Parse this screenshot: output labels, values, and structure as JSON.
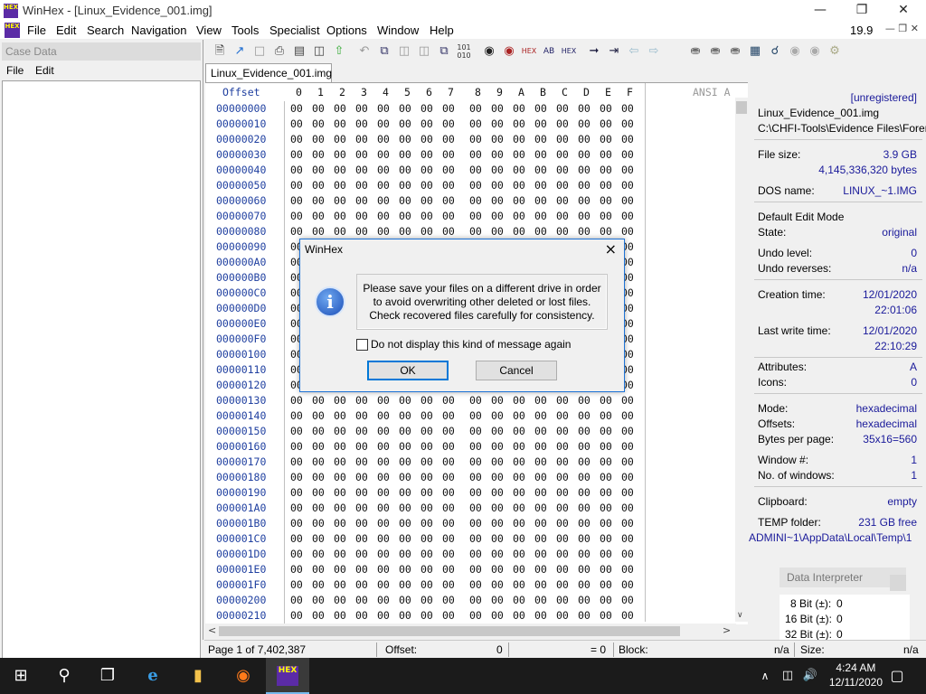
{
  "window": {
    "title": "WinHex - [Linux_Evidence_001.img]",
    "app_icon_text": "HEX",
    "mdi_version": "19.9"
  },
  "menu": [
    "File",
    "Edit",
    "Search",
    "Navigation",
    "View",
    "Tools",
    "Specialist",
    "Options",
    "Window",
    "Help"
  ],
  "case_pane": {
    "header": "Case Data",
    "menu_file": "File",
    "menu_edit": "Edit"
  },
  "tab": {
    "label": "Linux_Evidence_001.img"
  },
  "hex": {
    "offset_header": "Offset",
    "col_headers": [
      "0",
      "1",
      "2",
      "3",
      "4",
      "5",
      "6",
      "7",
      "8",
      "9",
      "A",
      "B",
      "C",
      "D",
      "E",
      "F"
    ],
    "ansi_header": "ANSI A",
    "offsets": [
      "00000000",
      "00000010",
      "00000020",
      "00000030",
      "00000040",
      "00000050",
      "00000060",
      "00000070",
      "00000080",
      "00000090",
      "000000A0",
      "000000B0",
      "000000C0",
      "000000D0",
      "000000E0",
      "000000F0",
      "00000100",
      "00000110",
      "00000120",
      "00000130",
      "00000140",
      "00000150",
      "00000160",
      "00000170",
      "00000180",
      "00000190",
      "000001A0",
      "000001B0",
      "000001C0",
      "000001D0",
      "000001E0",
      "000001F0",
      "00000200",
      "00000210"
    ],
    "byte_value": "00"
  },
  "info": {
    "registration": "[unregistered]",
    "file_name": "Linux_Evidence_001.img",
    "file_path": "C:\\CHFI-Tools\\Evidence Files\\Foren",
    "file_size_label": "File size:",
    "file_size": "3.9 GB",
    "file_size_bytes": "4,145,336,320 bytes",
    "dos_name_label": "DOS name:",
    "dos_name": "LINUX_~1.IMG",
    "edit_mode": "Default Edit Mode",
    "state_label": "State:",
    "state": "original",
    "undo_level_label": "Undo level:",
    "undo_level": "0",
    "undo_reverses_label": "Undo reverses:",
    "undo_reverses": "n/a",
    "creation_label": "Creation time:",
    "creation_date": "12/01/2020",
    "creation_time": "22:01:06",
    "last_write_label": "Last write time:",
    "last_write_date": "12/01/2020",
    "last_write_time": "22:10:29",
    "attributes_label": "Attributes:",
    "attributes": "A",
    "icons_label": "Icons:",
    "icons": "0",
    "mode_label": "Mode:",
    "mode": "hexadecimal",
    "offsets_label": "Offsets:",
    "offsets": "hexadecimal",
    "bpp_label": "Bytes per page:",
    "bpp": "35x16=560",
    "window_no_label": "Window #:",
    "window_no": "1",
    "no_windows_label": "No. of windows:",
    "no_windows": "1",
    "clipboard_label": "Clipboard:",
    "clipboard": "empty",
    "temp_label": "TEMP folder:",
    "temp_free": "231 GB free",
    "temp_path": "ADMINI~1\\AppData\\Local\\Temp\\1",
    "data_interpreter": "Data Interpreter",
    "bit8_label": "8 Bit (±):",
    "bit8": "0",
    "bit16_label": "16 Bit (±):",
    "bit16": "0",
    "bit32_label": "32 Bit (±):",
    "bit32": "0"
  },
  "status": {
    "page": "Page 1 of 7,402,387",
    "offset_label": "Offset:",
    "offset_value": "0",
    "eq": "= 0",
    "block_label": "Block:",
    "block_value": "n/a",
    "size_label": "Size:",
    "size_value": "n/a"
  },
  "dialog": {
    "title": "WinHex",
    "close": "×",
    "message_line1": "Please save your files on a different drive in order",
    "message_line2": "to avoid overwriting other deleted or lost files.",
    "message_line3": "Check recovered files carefully for consistency.",
    "checkbox_label": "Do not display this kind of message again",
    "ok_label": "OK",
    "cancel_label": "Cancel"
  },
  "taskbar": {
    "time": "4:24 AM",
    "date": "12/11/2020"
  },
  "colors": {
    "offset_blue": "#2040a0",
    "dialog_border": "#1e73d6",
    "taskbar_bg": "#1b1b1b"
  }
}
